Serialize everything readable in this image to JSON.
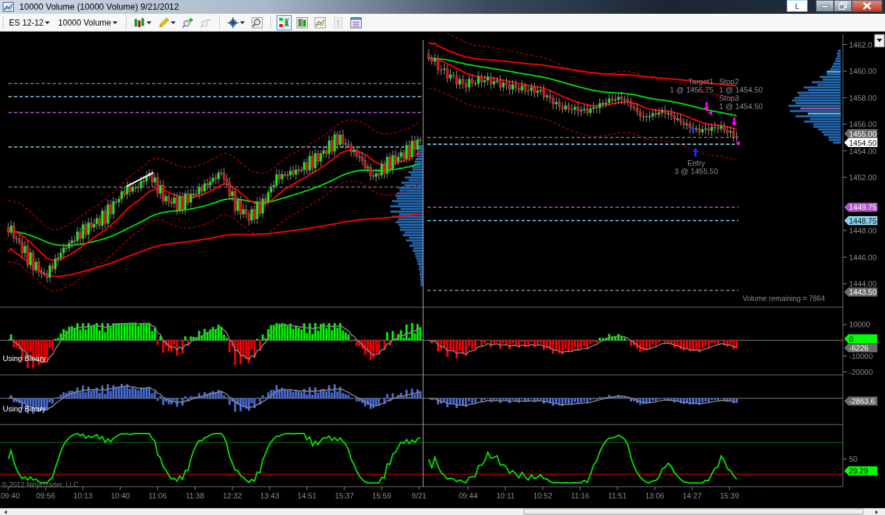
{
  "window": {
    "title": "10000 Volume (10000 Volume)  9/21/2012",
    "layout_button": "L"
  },
  "toolbar": {
    "instrument": "ES 12-12",
    "period": "10000 Volume",
    "tool_groups": [
      [
        {
          "kind": "bar-style",
          "dropdown": true,
          "selected": false,
          "disabled": false
        },
        {
          "kind": "drawing",
          "dropdown": true,
          "selected": false,
          "disabled": false
        },
        {
          "kind": "zoom-in",
          "dropdown": false,
          "selected": false,
          "disabled": false
        },
        {
          "kind": "zoom-out",
          "dropdown": false,
          "selected": false,
          "disabled": true
        }
      ],
      [
        {
          "kind": "crosshair",
          "dropdown": true,
          "selected": false,
          "disabled": false
        },
        {
          "kind": "magnifier",
          "dropdown": false,
          "selected": false,
          "disabled": false
        }
      ],
      [
        {
          "kind": "chart-trader",
          "dropdown": false,
          "selected": true,
          "disabled": false
        },
        {
          "kind": "data-box",
          "dropdown": false,
          "selected": false,
          "disabled": false
        },
        {
          "kind": "strategy",
          "dropdown": false,
          "selected": false,
          "disabled": false
        },
        {
          "kind": "order",
          "dropdown": false,
          "selected": false,
          "disabled": true
        },
        {
          "kind": "properties",
          "dropdown": false,
          "selected": false,
          "disabled": false
        }
      ]
    ]
  },
  "price_panel": {
    "ticks": [
      "1462.0",
      "1460.00",
      "1458.00",
      "1456.00",
      "1454.00",
      "1452.00",
      "1448.00",
      "1446.00",
      "1444.00"
    ],
    "markers": [
      {
        "label": "1455.00",
        "color": "#6b6b6b"
      },
      {
        "label": "1454.50",
        "color": "#ffffff"
      },
      {
        "label": "1449.75",
        "color": "#b455c8"
      },
      {
        "label": "1448.75",
        "color": "#87ceeb"
      },
      {
        "label": "1443.50",
        "color": "#6b6b6b"
      }
    ],
    "orders": [
      {
        "kind": "target",
        "name": "Target1",
        "detail": "1 @ 1456.75"
      },
      {
        "kind": "stop",
        "name": "Stop2",
        "detail": "1 @ 1454.50"
      },
      {
        "kind": "stop",
        "name": "Stop3",
        "detail": "1 @ 1454.50"
      },
      {
        "kind": "entry",
        "name": "Entry",
        "detail": "3 @ 1455.50"
      }
    ],
    "volume_remaining": "Volume remaining = 7864"
  },
  "indicator_panels": [
    {
      "label": "Using Binary",
      "ticks": [
        "10000",
        "-10000",
        "-20000"
      ],
      "markers": [
        {
          "label": "0",
          "color": "#00ff00"
        },
        {
          "label": "-6226",
          "color": "#6b6b6b"
        }
      ]
    },
    {
      "label": "Using Binary",
      "markers": [
        {
          "label": "-2863.6",
          "color": "#6b6b6b"
        }
      ]
    },
    {
      "ticks": [
        "50"
      ],
      "markers": [
        {
          "label": "29.29",
          "color": "#00ff00"
        }
      ]
    }
  ],
  "copyright": "© 2012 NinjaTrader, LLC",
  "time_axis": [
    "09:40",
    "09:56",
    "10:13",
    "10:40",
    "11:06",
    "11:38",
    "12:32",
    "13:43",
    "14:51",
    "15:37",
    "15:59",
    "9/21",
    "09:44",
    "10:11",
    "10:52",
    "11:16",
    "11:51",
    "13:06",
    "14:27",
    "15:39"
  ]
}
